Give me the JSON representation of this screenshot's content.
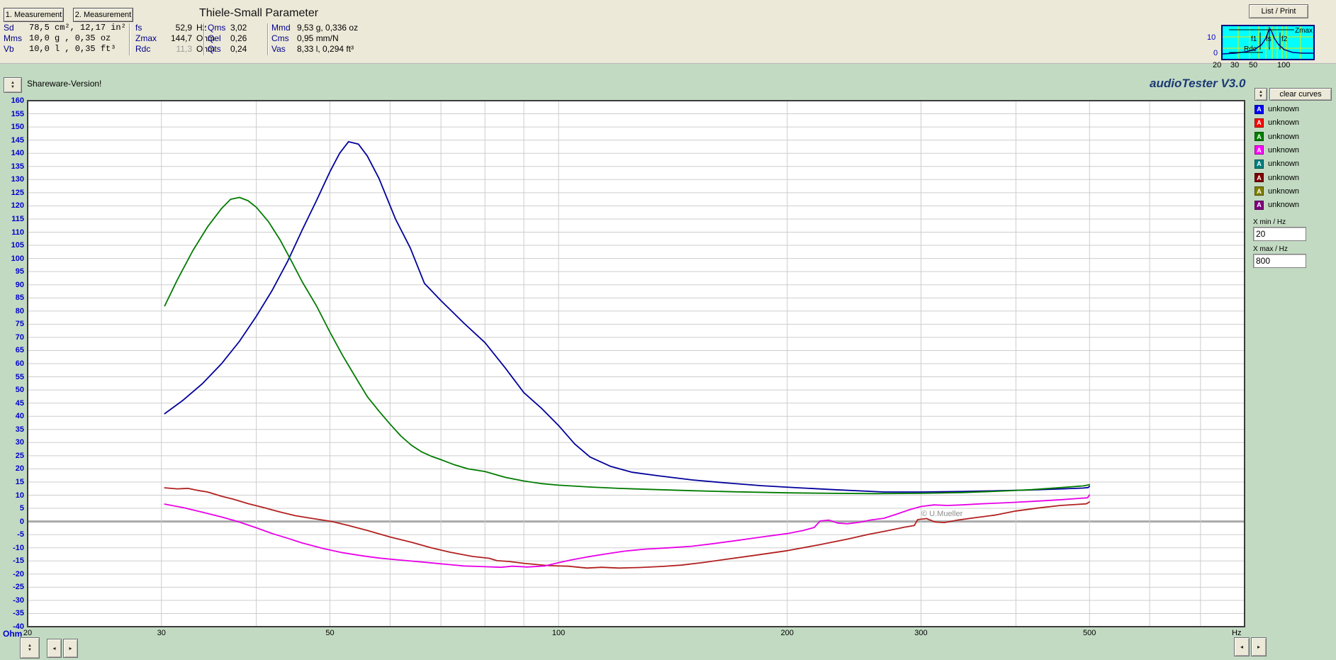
{
  "param_panel": {
    "measure1_button": "1. Measurement",
    "measure2_button": "2. Measurement",
    "title": "Thiele-Small Parameter",
    "list_print_button": "List / Print",
    "columns": {
      "col1": [
        {
          "label": "Sd",
          "value": "78,5 cm², 12,17 in²"
        },
        {
          "label": "Mms",
          "value": "10,0 g , 0,35 oz"
        },
        {
          "label": "Vb",
          "value": "10,0 l , 0,35 ft³"
        }
      ],
      "col2": [
        {
          "label": "fs",
          "value": "52,9",
          "unit": "Hz",
          "muted": false
        },
        {
          "label": "Zmax",
          "value": "144,7",
          "unit": "Ohm",
          "muted": false
        },
        {
          "label": "Rdc",
          "value": "11,3",
          "unit": "Ohm",
          "muted": true
        }
      ],
      "col3": [
        {
          "label": "Qms",
          "value": "3,02"
        },
        {
          "label": "Qel",
          "value": "0,26"
        },
        {
          "label": "Qts",
          "value": "0,24"
        }
      ],
      "col4": [
        {
          "label": "Mmd",
          "value": "9,53 g, 0,336 oz"
        },
        {
          "label": "Cms",
          "value": "0,95 mm/N"
        },
        {
          "label": "Vas",
          "value": "8,33 l, 0,294 ft³"
        }
      ]
    },
    "thumbnail": {
      "zmax_label": "Zmax",
      "f1_label": "f1",
      "fs_label": "fs",
      "f2_label": "f2",
      "rdc_label": "Rdc",
      "y_ticks": [
        "10",
        "0"
      ],
      "x_ticks": [
        "20",
        "30",
        "50",
        "100"
      ],
      "bg_color": "#00FFFF",
      "grid_color": "#E8E800",
      "curve_color": "#00008B"
    }
  },
  "main": {
    "shareware_note": "Shareware-Version!",
    "app_title": "audioTester  V3.0",
    "copyright": "© U.Mueller",
    "y_axis_unit": "Ohm",
    "x_axis_unit": "Hz"
  },
  "side_panel": {
    "clear_curves_button": "clear curves",
    "legend": [
      {
        "letter": "A",
        "color": "#0000FF",
        "label": "unknown"
      },
      {
        "letter": "A",
        "color": "#FF0000",
        "label": "unknown"
      },
      {
        "letter": "A",
        "color": "#008000",
        "label": "unknown"
      },
      {
        "letter": "A",
        "color": "#FF00FF",
        "label": "unknown"
      },
      {
        "letter": "A",
        "color": "#008080",
        "label": "unknown"
      },
      {
        "letter": "A",
        "color": "#800000",
        "label": "unknown"
      },
      {
        "letter": "A",
        "color": "#808000",
        "label": "unknown"
      },
      {
        "letter": "A",
        "color": "#800080",
        "label": "unknown"
      }
    ],
    "xmin_label": "X min / Hz",
    "xmin_value": "20",
    "xmax_label": "X max / Hz",
    "xmax_value": "800"
  },
  "chart_data": {
    "type": "line",
    "x_axis": {
      "scale": "log",
      "min": 20,
      "max": 800,
      "unit": "Hz",
      "ticks": [
        20,
        30,
        50,
        100,
        200,
        300,
        500
      ],
      "gridlines": [
        30,
        40,
        50,
        60,
        70,
        80,
        90,
        100,
        200,
        300,
        400,
        500,
        600,
        700
      ]
    },
    "y_axis": {
      "min": -40,
      "max": 160,
      "step": 5,
      "unit": "Ohm",
      "zero_line_emphasized": true
    },
    "grid": true,
    "series": [
      {
        "name": "impedance-curve-blue",
        "color": "#00009B",
        "points": [
          [
            30.3,
            41
          ],
          [
            32,
            46
          ],
          [
            34,
            52.5
          ],
          [
            36,
            60
          ],
          [
            38,
            68.5
          ],
          [
            40,
            78
          ],
          [
            42,
            88
          ],
          [
            44,
            99
          ],
          [
            46,
            111
          ],
          [
            48,
            122
          ],
          [
            50,
            133
          ],
          [
            51.5,
            140
          ],
          [
            52.9,
            144.4
          ],
          [
            54.5,
            143.5
          ],
          [
            56,
            139
          ],
          [
            58,
            130.5
          ],
          [
            61,
            115
          ],
          [
            63.8,
            104
          ],
          [
            66.6,
            90.5
          ],
          [
            70,
            84
          ],
          [
            75,
            75.5
          ],
          [
            80,
            68
          ],
          [
            85,
            58.5
          ],
          [
            90,
            49
          ],
          [
            95,
            43
          ],
          [
            100,
            36.5
          ],
          [
            105,
            29.5
          ],
          [
            110,
            24.5
          ],
          [
            117,
            21
          ],
          [
            125,
            18.7
          ],
          [
            135,
            17.4
          ],
          [
            150,
            15.8
          ],
          [
            167,
            14.6
          ],
          [
            185,
            13.6
          ],
          [
            207,
            12.8
          ],
          [
            230,
            12.1
          ],
          [
            268,
            11.2
          ],
          [
            300,
            11.2
          ],
          [
            340,
            11.4
          ],
          [
            380,
            11.7
          ],
          [
            420,
            12.0
          ],
          [
            460,
            12.4
          ],
          [
            490,
            12.7
          ],
          [
            498,
            12.9
          ],
          [
            500,
            13.4
          ]
        ]
      },
      {
        "name": "impedance-curve-green",
        "color": "#007B00",
        "points": [
          [
            30.3,
            82
          ],
          [
            31.5,
            92
          ],
          [
            33,
            103
          ],
          [
            34.5,
            112
          ],
          [
            36,
            119
          ],
          [
            37,
            122.5
          ],
          [
            38,
            123.2
          ],
          [
            39,
            122
          ],
          [
            40,
            119.5
          ],
          [
            41.5,
            114
          ],
          [
            43,
            107
          ],
          [
            44.5,
            99
          ],
          [
            46,
            91
          ],
          [
            48,
            82
          ],
          [
            50,
            72
          ],
          [
            52,
            63
          ],
          [
            54,
            55
          ],
          [
            56,
            47.5
          ],
          [
            58,
            42
          ],
          [
            60,
            37
          ],
          [
            62,
            32.5
          ],
          [
            64,
            29
          ],
          [
            66,
            26.5
          ],
          [
            68,
            24.8
          ],
          [
            70,
            23.5
          ],
          [
            73,
            21.5
          ],
          [
            76,
            20
          ],
          [
            80,
            19
          ],
          [
            85,
            16.8
          ],
          [
            90,
            15.4
          ],
          [
            95,
            14.4
          ],
          [
            100,
            13.8
          ],
          [
            110,
            13.1
          ],
          [
            120,
            12.6
          ],
          [
            135,
            12.1
          ],
          [
            150,
            11.7
          ],
          [
            170,
            11.3
          ],
          [
            200,
            10.9
          ],
          [
            230,
            10.7
          ],
          [
            260,
            10.6
          ],
          [
            300,
            10.7
          ],
          [
            340,
            11.0
          ],
          [
            380,
            11.5
          ],
          [
            420,
            12.1
          ],
          [
            460,
            12.9
          ],
          [
            490,
            13.5
          ],
          [
            500,
            14.0
          ]
        ]
      },
      {
        "name": "phase-curve-red",
        "color": "#B22020",
        "points": [
          [
            30.3,
            12.8
          ],
          [
            31.5,
            12.4
          ],
          [
            32.5,
            12.6
          ],
          [
            33.5,
            11.8
          ],
          [
            34.5,
            11.2
          ],
          [
            36,
            9.6
          ],
          [
            37.3,
            8.5
          ],
          [
            39,
            6.8
          ],
          [
            41,
            5.2
          ],
          [
            43,
            3.6
          ],
          [
            45,
            2.2
          ],
          [
            47.5,
            1.1
          ],
          [
            50.3,
            0
          ],
          [
            53,
            -1.6
          ],
          [
            56,
            -3.4
          ],
          [
            60,
            -5.9
          ],
          [
            64,
            -7.9
          ],
          [
            68,
            -10
          ],
          [
            72,
            -11.7
          ],
          [
            77,
            -13.3
          ],
          [
            81,
            -14
          ],
          [
            83,
            -14.9
          ],
          [
            86,
            -15.2
          ],
          [
            90,
            -15.9
          ],
          [
            97,
            -16.8
          ],
          [
            103,
            -17
          ],
          [
            109,
            -17.7
          ],
          [
            114,
            -17.4
          ],
          [
            120,
            -17.7
          ],
          [
            128,
            -17.5
          ],
          [
            137,
            -17.1
          ],
          [
            145,
            -16.6
          ],
          [
            155,
            -15.6
          ],
          [
            165,
            -14.5
          ],
          [
            180,
            -13
          ],
          [
            200,
            -11.1
          ],
          [
            220,
            -8.9
          ],
          [
            240,
            -6.7
          ],
          [
            256,
            -4.9
          ],
          [
            270,
            -3.6
          ],
          [
            285,
            -2.2
          ],
          [
            294,
            -1.5
          ],
          [
            297,
            0.7
          ],
          [
            305,
            1.1
          ],
          [
            313,
            -0.2
          ],
          [
            322,
            -0.4
          ],
          [
            335,
            0.5
          ],
          [
            355,
            1.5
          ],
          [
            375,
            2.4
          ],
          [
            400,
            4
          ],
          [
            430,
            5.2
          ],
          [
            458,
            6.1
          ],
          [
            482,
            6.5
          ],
          [
            495,
            6.7
          ],
          [
            500,
            7.4
          ]
        ]
      },
      {
        "name": "phase-curve-magenta",
        "color": "#E800E8",
        "points": [
          [
            30.3,
            6.6
          ],
          [
            32,
            5.3
          ],
          [
            34,
            3.5
          ],
          [
            36,
            1.7
          ],
          [
            37.8,
            0
          ],
          [
            40,
            -2.4
          ],
          [
            42,
            -4.6
          ],
          [
            44,
            -6.4
          ],
          [
            46,
            -8.2
          ],
          [
            49,
            -10.3
          ],
          [
            52,
            -11.9
          ],
          [
            55,
            -13
          ],
          [
            58,
            -13.9
          ],
          [
            62,
            -14.7
          ],
          [
            66,
            -15.4
          ],
          [
            70,
            -16.1
          ],
          [
            75,
            -16.9
          ],
          [
            80,
            -17.2
          ],
          [
            84,
            -17.4
          ],
          [
            87,
            -17
          ],
          [
            91,
            -17.3
          ],
          [
            96,
            -16.9
          ],
          [
            100,
            -15.7
          ],
          [
            104,
            -14.6
          ],
          [
            109,
            -13.5
          ],
          [
            115,
            -12.4
          ],
          [
            122,
            -11.3
          ],
          [
            130,
            -10.5
          ],
          [
            140,
            -10
          ],
          [
            150,
            -9.4
          ],
          [
            160,
            -8.4
          ],
          [
            172,
            -7.2
          ],
          [
            185,
            -5.9
          ],
          [
            200,
            -4.6
          ],
          [
            210,
            -3.4
          ],
          [
            217,
            -2.3
          ],
          [
            221,
            0.2
          ],
          [
            227,
            0.5
          ],
          [
            233,
            -0.6
          ],
          [
            240,
            -0.9
          ],
          [
            249,
            -0.3
          ],
          [
            258,
            0.6
          ],
          [
            268,
            1.2
          ],
          [
            280,
            3
          ],
          [
            290,
            4.5
          ],
          [
            300,
            5.7
          ],
          [
            312,
            6.3
          ],
          [
            325,
            6.1
          ],
          [
            340,
            6.3
          ],
          [
            360,
            6.7
          ],
          [
            380,
            7
          ],
          [
            400,
            7.3
          ],
          [
            430,
            7.8
          ],
          [
            460,
            8.3
          ],
          [
            485,
            8.8
          ],
          [
            497,
            9
          ],
          [
            500,
            10.1
          ]
        ]
      }
    ]
  }
}
